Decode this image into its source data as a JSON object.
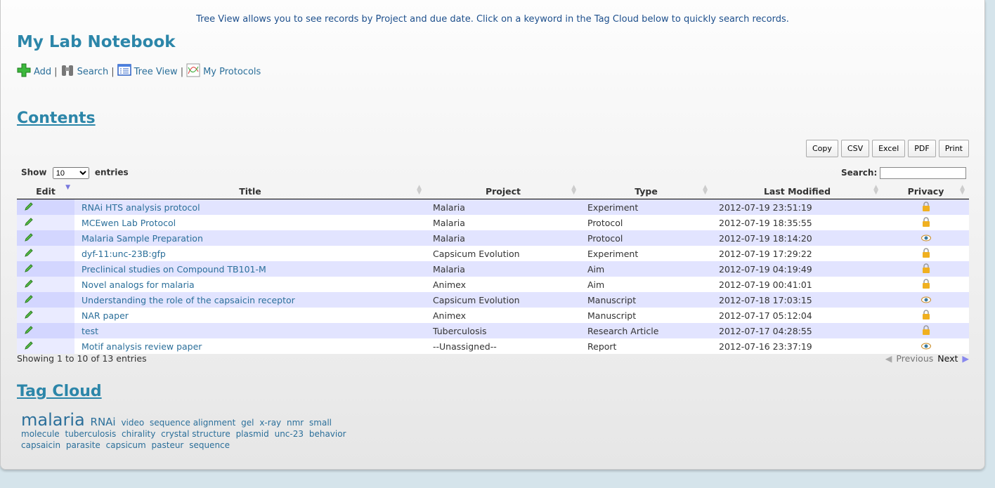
{
  "info": "Tree View allows you to see records by Project and due date. Click on a keyword in the Tag Cloud below to quickly search records.",
  "title": "My Lab Notebook",
  "nav": {
    "add": "Add",
    "search": "Search",
    "tree": "Tree View",
    "protocols": "My Protocols",
    "separator": "|"
  },
  "contents_heading": "Contents",
  "export_buttons": {
    "copy": "Copy",
    "csv": "CSV",
    "excel": "Excel",
    "pdf": "PDF",
    "print": "Print"
  },
  "show": {
    "label": "Show",
    "value": "10",
    "suffix": "entries"
  },
  "search_label": "Search:",
  "columns": [
    "Edit",
    "Title",
    "Project",
    "Type",
    "Last Modified",
    "Privacy"
  ],
  "rows": [
    {
      "title": "RNAi HTS analysis protocol",
      "project": "Malaria",
      "type": "Experiment",
      "modified": "2012-07-19 23:51:19",
      "privacy": "lock"
    },
    {
      "title": "MCEwen Lab Protocol",
      "project": "Malaria",
      "type": "Protocol",
      "modified": "2012-07-19 18:35:55",
      "privacy": "lock"
    },
    {
      "title": "Malaria Sample Preparation",
      "project": "Malaria",
      "type": "Protocol",
      "modified": "2012-07-19 18:14:20",
      "privacy": "eye"
    },
    {
      "title": "dyf-11:unc-23B:gfp",
      "project": "Capsicum Evolution",
      "type": "Experiment",
      "modified": "2012-07-19 17:29:22",
      "privacy": "lock"
    },
    {
      "title": "Preclinical studies on Compound TB101-M",
      "project": "Malaria",
      "type": "Aim",
      "modified": "2012-07-19 04:19:49",
      "privacy": "lock"
    },
    {
      "title": "Novel analogs for malaria",
      "project": "Animex",
      "type": "Aim",
      "modified": "2012-07-19 00:41:01",
      "privacy": "lock"
    },
    {
      "title": "Understanding the role of the capsaicin receptor",
      "project": "Capsicum Evolution",
      "type": "Manuscript",
      "modified": "2012-07-18 17:03:15",
      "privacy": "eye"
    },
    {
      "title": "NAR paper",
      "project": "Animex",
      "type": "Manuscript",
      "modified": "2012-07-17 05:12:04",
      "privacy": "lock"
    },
    {
      "title": "test",
      "project": "Tuberculosis",
      "type": "Research Article",
      "modified": "2012-07-17 04:28:55",
      "privacy": "lock"
    },
    {
      "title": "Motif analysis review paper",
      "project": "--Unassigned--",
      "type": "Report",
      "modified": "2012-07-16 23:37:19",
      "privacy": "eye"
    }
  ],
  "footer": "Showing 1 to 10 of 13 entries",
  "pager": {
    "previous": "Previous",
    "next": "Next"
  },
  "tag_heading": "Tag Cloud",
  "tags": [
    {
      "t": "malaria",
      "size": 24
    },
    {
      "t": "RNAi",
      "size": 15
    },
    {
      "t": "video",
      "size": 12
    },
    {
      "t": "sequence alignment",
      "size": 12
    },
    {
      "t": "gel",
      "size": 12
    },
    {
      "t": "x-ray",
      "size": 12
    },
    {
      "t": "nmr",
      "size": 12
    },
    {
      "t": "small molecule",
      "size": 12
    },
    {
      "t": "tuberculosis",
      "size": 12
    },
    {
      "t": "chirality",
      "size": 12
    },
    {
      "t": "crystal structure",
      "size": 12
    },
    {
      "t": "plasmid",
      "size": 12
    },
    {
      "t": "unc-23",
      "size": 12
    },
    {
      "t": "behavior",
      "size": 12
    },
    {
      "t": "capsaicin",
      "size": 12
    },
    {
      "t": "parasite",
      "size": 12
    },
    {
      "t": "capsicum",
      "size": 12
    },
    {
      "t": "pasteur",
      "size": 12
    },
    {
      "t": "sequence",
      "size": 12
    }
  ]
}
